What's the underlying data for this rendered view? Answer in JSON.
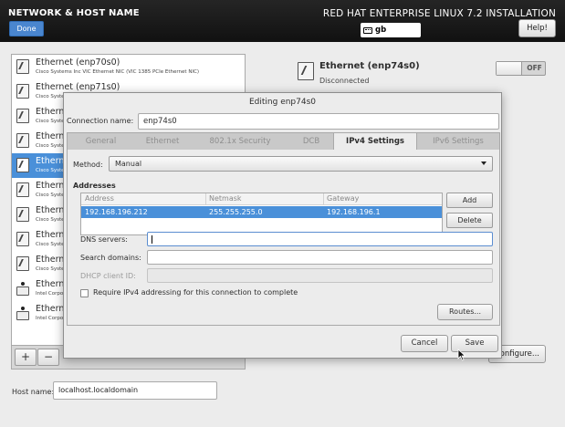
{
  "header": {
    "title": "NETWORK & HOST NAME",
    "done_label": "Done",
    "installer_title": "RED HAT ENTERPRISE LINUX 7.2 INSTALLATION",
    "keyboard_layout": "gb",
    "help_label": "Help!"
  },
  "devices": [
    {
      "name": "Ethernet (enp70s0)",
      "desc": "Cisco Systems Inc VIC Ethernet NIC (VIC 1385 PCIe Ethernet NIC)",
      "icon": "plug-icon"
    },
    {
      "name": "Ethernet (enp71s0)",
      "desc": "Cisco Syste",
      "icon": "plug-icon"
    },
    {
      "name": "Etherne",
      "desc": "Cisco Syste",
      "icon": "plug-icon"
    },
    {
      "name": "Etherne",
      "desc": "Cisco Syste",
      "icon": "plug-icon"
    },
    {
      "name": "Etherne",
      "desc": "Cisco Syste",
      "icon": "plug-icon",
      "selected": true
    },
    {
      "name": "Etherne",
      "desc": "Cisco Syste",
      "icon": "plug-icon"
    },
    {
      "name": "Etherne",
      "desc": "Cisco Syste",
      "icon": "plug-icon"
    },
    {
      "name": "Etherne",
      "desc": "Cisco Syste",
      "icon": "plug-icon"
    },
    {
      "name": "Etherne",
      "desc": "Cisco Syste",
      "icon": "plug-icon"
    },
    {
      "name": "Etherne",
      "desc": "Intel Corpo",
      "icon": "network-card-icon"
    },
    {
      "name": "Etherne",
      "desc": "Intel Corpo",
      "icon": "network-card-icon"
    }
  ],
  "device_list_controls": {
    "add_label": "+",
    "remove_label": "−"
  },
  "hostname": {
    "label": "Host name:",
    "value": "localhost.localdomain"
  },
  "selected_device": {
    "title": "Ethernet (enp74s0)",
    "status": "Disconnected",
    "toggle_state": "OFF",
    "configure_label": "Configure..."
  },
  "dialog": {
    "title": "Editing enp74s0",
    "connection_name_label": "Connection name:",
    "connection_name": "enp74s0",
    "tabs": [
      "General",
      "Ethernet",
      "802.1x Security",
      "DCB",
      "IPv4 Settings",
      "IPv6 Settings"
    ],
    "active_tab": "IPv4 Settings",
    "method_label": "Method:",
    "method_value": "Manual",
    "addresses_label": "Addresses",
    "address_columns": [
      "Address",
      "Netmask",
      "Gateway"
    ],
    "address_rows": [
      {
        "address": "192.168.196.212",
        "netmask": "255.255.255.0",
        "gateway": "192.168.196.1"
      }
    ],
    "add_label": "Add",
    "delete_label": "Delete",
    "dns_label": "DNS servers:",
    "dns_value": "",
    "search_label": "Search domains:",
    "search_value": "",
    "dhcp_label": "DHCP client ID:",
    "dhcp_value": "",
    "require_ipv4_label": "Require IPv4 addressing for this connection to complete",
    "require_ipv4_checked": false,
    "routes_label": "Routes...",
    "cancel_label": "Cancel",
    "save_label": "Save"
  }
}
